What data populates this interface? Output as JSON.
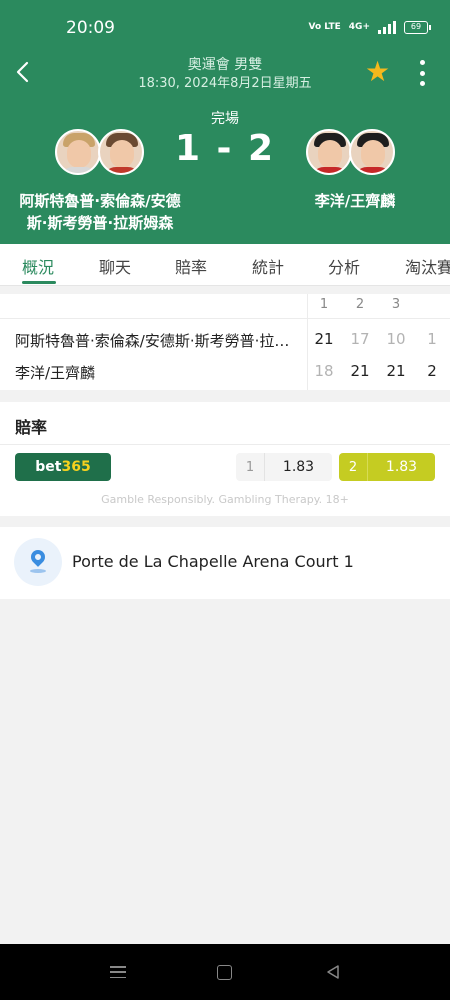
{
  "status_bar": {
    "time": "20:09",
    "volte": "Vo LTE",
    "network": "4G+",
    "battery": "69"
  },
  "header": {
    "league": "奧運會 男雙",
    "datetime": "18:30, 2024年8月2日星期五",
    "status": "完場",
    "score": "1 - 2",
    "team1": {
      "line1": "阿斯特魯普·索倫森/安德",
      "line2": "斯·斯考勞普·拉斯姆森"
    },
    "team2": {
      "name": "李洋/王齊麟"
    }
  },
  "tabs": [
    {
      "label": "概況",
      "active": true
    },
    {
      "label": "聊天"
    },
    {
      "label": "賠率"
    },
    {
      "label": "統計"
    },
    {
      "label": "分析"
    },
    {
      "label": "淘汰賽"
    }
  ],
  "scoreboard": {
    "set_headers": [
      "1",
      "2",
      "3"
    ],
    "rows": [
      {
        "name": "阿斯特魯普·索倫森/安德斯·斯考勞普·拉斯姆森",
        "sets": [
          "21",
          "17",
          "10"
        ],
        "total": "1"
      },
      {
        "name": "李洋/王齊麟",
        "sets": [
          "18",
          "21",
          "21"
        ],
        "total": "2"
      }
    ]
  },
  "odds": {
    "title": "賠率",
    "bookmaker_main": "bet",
    "bookmaker_highlight": "365",
    "home": {
      "index": "1",
      "value": "1.83"
    },
    "away": {
      "index": "2",
      "value": "1.83"
    },
    "disclaimer": "Gamble Responsibly. Gambling Therapy. 18+"
  },
  "venue": {
    "name": "Porte de La Chapelle Arena Court 1"
  },
  "colors": {
    "primary_green": "#2b8a5e",
    "star": "#f5b81c",
    "odds_highlight": "#c5cc22"
  }
}
